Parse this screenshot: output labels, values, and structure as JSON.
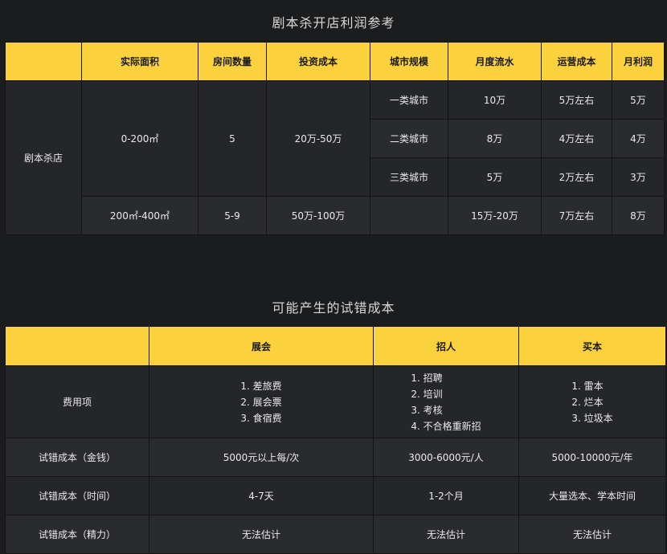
{
  "table1": {
    "title": "剧本杀开店利润参考",
    "headers": [
      "",
      "实际面积",
      "房间数量",
      "投资成本",
      "城市规模",
      "月度流水",
      "运营成本",
      "月利润"
    ],
    "store_type": "剧本杀店",
    "group1": {
      "area": "0-200㎡",
      "rooms": "5",
      "investment": "20万-50万",
      "rows": [
        {
          "city": "一类城市",
          "revenue": "10万",
          "cost": "5万左右",
          "profit": "5万"
        },
        {
          "city": "二类城市",
          "revenue": "8万",
          "cost": "4万左右",
          "profit": "4万"
        },
        {
          "city": "三类城市",
          "revenue": "5万",
          "cost": "2万左右",
          "profit": "3万"
        }
      ]
    },
    "group2": {
      "area": "200㎡-400㎡",
      "rooms": "5-9",
      "investment": "50万-100万",
      "city": "",
      "revenue": "15万-20万",
      "cost": "7万左右",
      "profit": "8万"
    }
  },
  "table2": {
    "title": "可能产生的试错成本",
    "headers": [
      "",
      "展会",
      "招人",
      "买本"
    ],
    "expense_label": "费用项",
    "expense_items": {
      "exhibition": [
        "1. 差旅费",
        "2. 展会票",
        "3. 食宿费"
      ],
      "hiring": [
        "1. 招聘",
        "2. 培训",
        "3. 考核",
        "4. 不合格重新招"
      ],
      "scripts": [
        "1. 雷本",
        "2. 烂本",
        "3. 垃圾本"
      ]
    },
    "rows": [
      {
        "label": "试错成本（金钱）",
        "exhibition": "5000元以上每/次",
        "hiring": "3000-6000元/人",
        "scripts": "5000-10000元/年"
      },
      {
        "label": "试错成本（时间）",
        "exhibition": "4-7天",
        "hiring": "1-2个月",
        "scripts": "大量选本、学本时间"
      },
      {
        "label": "试错成本（精力）",
        "exhibition": "无法估计",
        "hiring": "无法估计",
        "scripts": "无法估计"
      }
    ]
  },
  "colors": {
    "header_bg": "#fbd23e",
    "cell_bg": "#25262a",
    "page_bg": "#1b1c1e"
  }
}
